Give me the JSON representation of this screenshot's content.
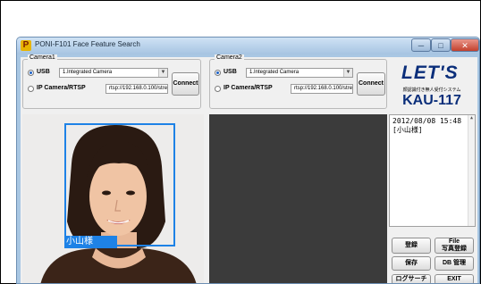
{
  "window": {
    "app_icon": "P",
    "title": "PONI-F101 Face Feature Search",
    "controls": {
      "minimize": "─",
      "maximize": "□",
      "close": "✕"
    }
  },
  "camera1": {
    "group_label": "Camera1",
    "usb_label": "USB",
    "usb_selected": true,
    "device_value": "1.Integrated Camera",
    "ip_label": "IP Camera/RTSP",
    "rtsp_value": "rtsp://192.168.0.100/stre",
    "connect_label": "Connect"
  },
  "camera2": {
    "group_label": "Camera2",
    "usb_label": "USB",
    "usb_selected": true,
    "device_value": "1.Integrated Camera",
    "ip_label": "IP Camera/RTSP",
    "rtsp_value": "rtsp://192.168.0.100/stre",
    "connect_label": "Connect"
  },
  "logo": {
    "brand": "LET'S",
    "subtitle": "顔認識付き無人受付システム",
    "model": "KAU-117"
  },
  "log": {
    "lines": [
      "2012/08/08 15:48",
      "[小山様]"
    ]
  },
  "face": {
    "name_label": "小山様"
  },
  "buttons": {
    "register": "登録",
    "file_register_top": "File",
    "file_register_bottom": "写真登録",
    "save": "保存",
    "db_manage": "DB 管理",
    "log_search": "ログサーチ",
    "exit": "EXIT"
  },
  "colors": {
    "face_box": "#1e82e6",
    "brand": "#0a2e7a",
    "close_button": "#c3402c"
  }
}
